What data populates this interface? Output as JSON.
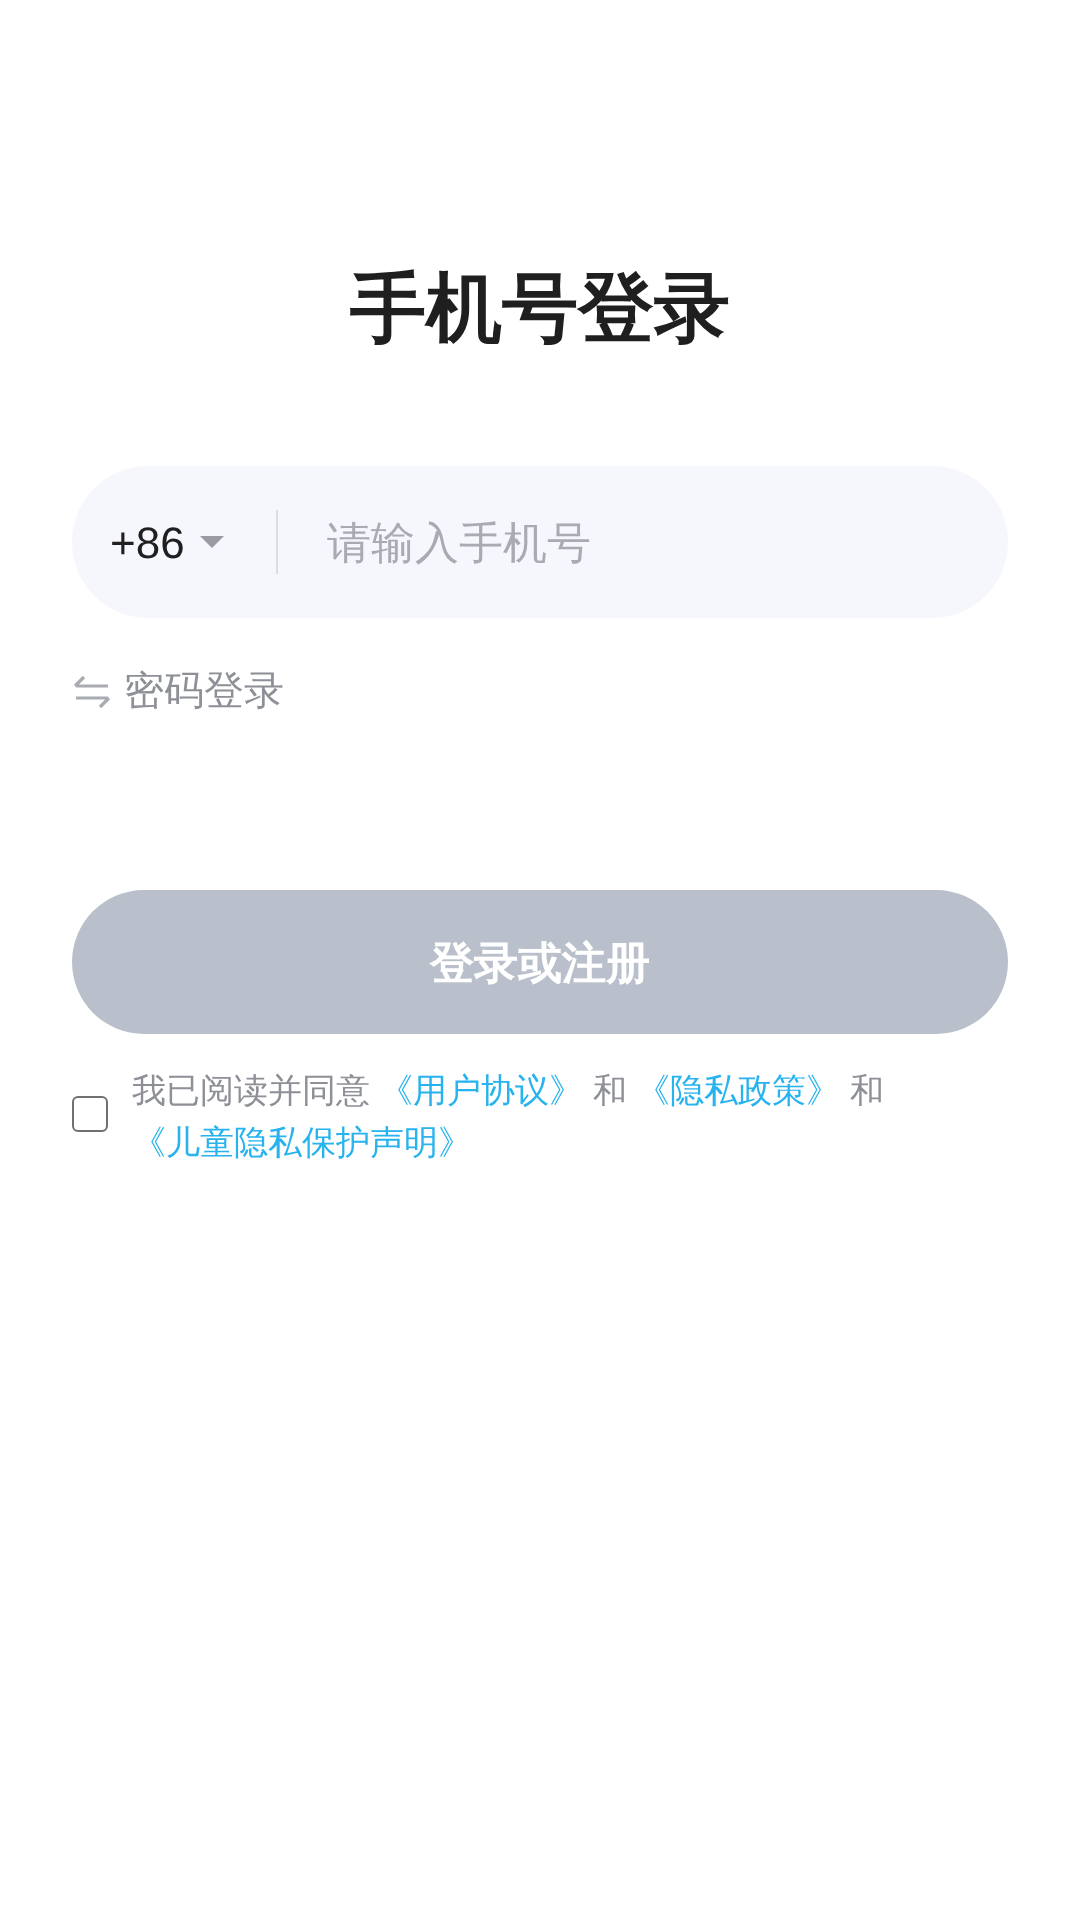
{
  "title": "手机号登录",
  "phone_field": {
    "country_code": "+86",
    "placeholder": "请输入手机号"
  },
  "switch_link": {
    "label": "密码登录"
  },
  "submit_button": {
    "label": "登录或注册",
    "disabled": true
  },
  "agreement": {
    "checked": false,
    "parts": [
      {
        "kind": "text",
        "text": "我已阅读并同意 "
      },
      {
        "kind": "link",
        "text": "《用户协议》"
      },
      {
        "kind": "text",
        "text": " 和 "
      },
      {
        "kind": "link",
        "text": "《隐私政策》"
      },
      {
        "kind": "text",
        "text": " 和 "
      },
      {
        "kind": "link",
        "text": "《儿童隐私保护声明》"
      }
    ]
  }
}
